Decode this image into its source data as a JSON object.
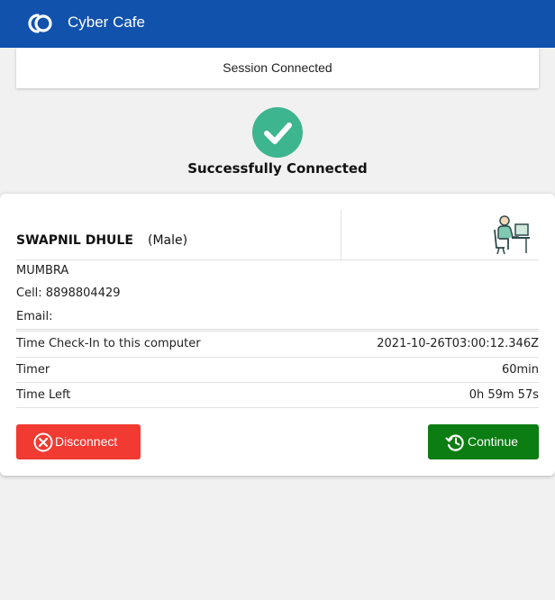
{
  "app": {
    "title": "Cyber Cafe",
    "logo_icon": "app-logo-icon"
  },
  "session": {
    "status": "Session Connected"
  },
  "success": {
    "icon": "check-circle-icon",
    "message": "Successfully Connected",
    "color": "#3db58f"
  },
  "user": {
    "name": "SWAPNIL DHULE",
    "gender": "(Male)",
    "location": "MUMBRA",
    "cell": "Cell: 8898804429",
    "email": "Email:",
    "avatar_icon": "person-at-computer-icon"
  },
  "details": [
    {
      "label": "Time Check-In to this computer",
      "value": "2021-10-26T03:00:12.346Z"
    },
    {
      "label": "Timer",
      "value": "60min"
    },
    {
      "label": "Time Left",
      "value": "0h 59m 57s"
    }
  ],
  "actions": {
    "disconnect": {
      "label": "Disconnect",
      "icon": "close-circle-icon",
      "color": "#f13a31"
    },
    "continue": {
      "label": "Continue",
      "icon": "history-icon",
      "color": "#0b7d12"
    }
  },
  "colors": {
    "header": "#1152ad",
    "background": "#f1f1f1"
  }
}
